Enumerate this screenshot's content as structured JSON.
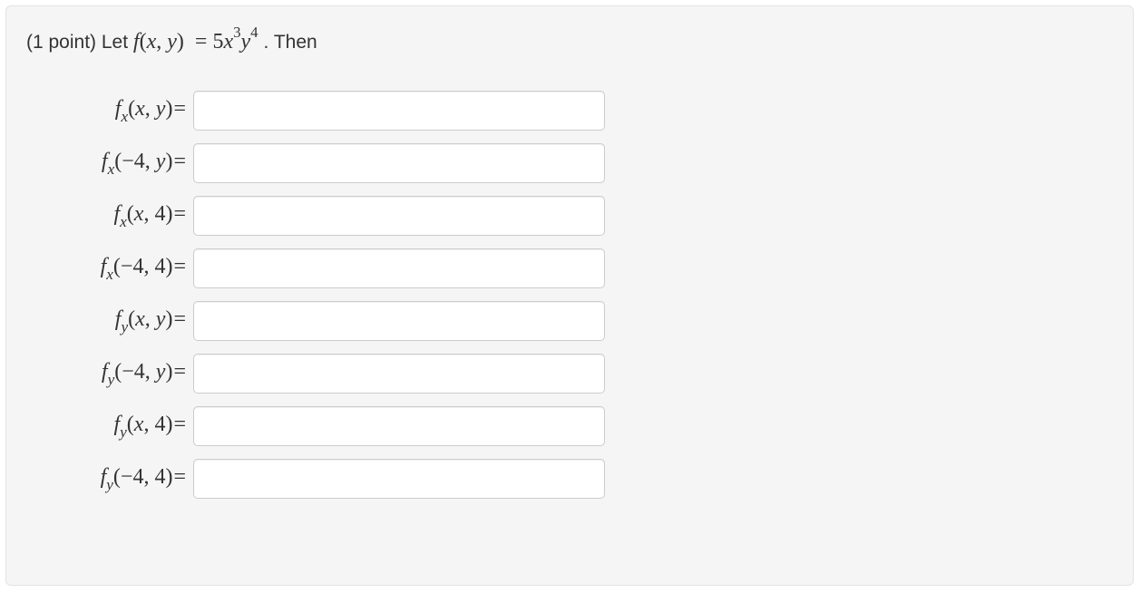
{
  "problem": {
    "points_prefix": "(1 point) Let ",
    "function_html": "f(x, y) = 5x³y⁴",
    "suffix": " . Then"
  },
  "rows": [
    {
      "label_sub": "x",
      "label_args": "(x, y)",
      "value": ""
    },
    {
      "label_sub": "x",
      "label_args": "(−4, y)",
      "value": ""
    },
    {
      "label_sub": "x",
      "label_args": "(x, 4)",
      "value": ""
    },
    {
      "label_sub": "x",
      "label_args": "(−4, 4)",
      "value": ""
    },
    {
      "label_sub": "y",
      "label_args": "(x, y)",
      "value": ""
    },
    {
      "label_sub": "y",
      "label_args": "(−4, y)",
      "value": ""
    },
    {
      "label_sub": "y",
      "label_args": "(x, 4)",
      "value": ""
    },
    {
      "label_sub": "y",
      "label_args": "(−4, 4)",
      "value": ""
    }
  ]
}
